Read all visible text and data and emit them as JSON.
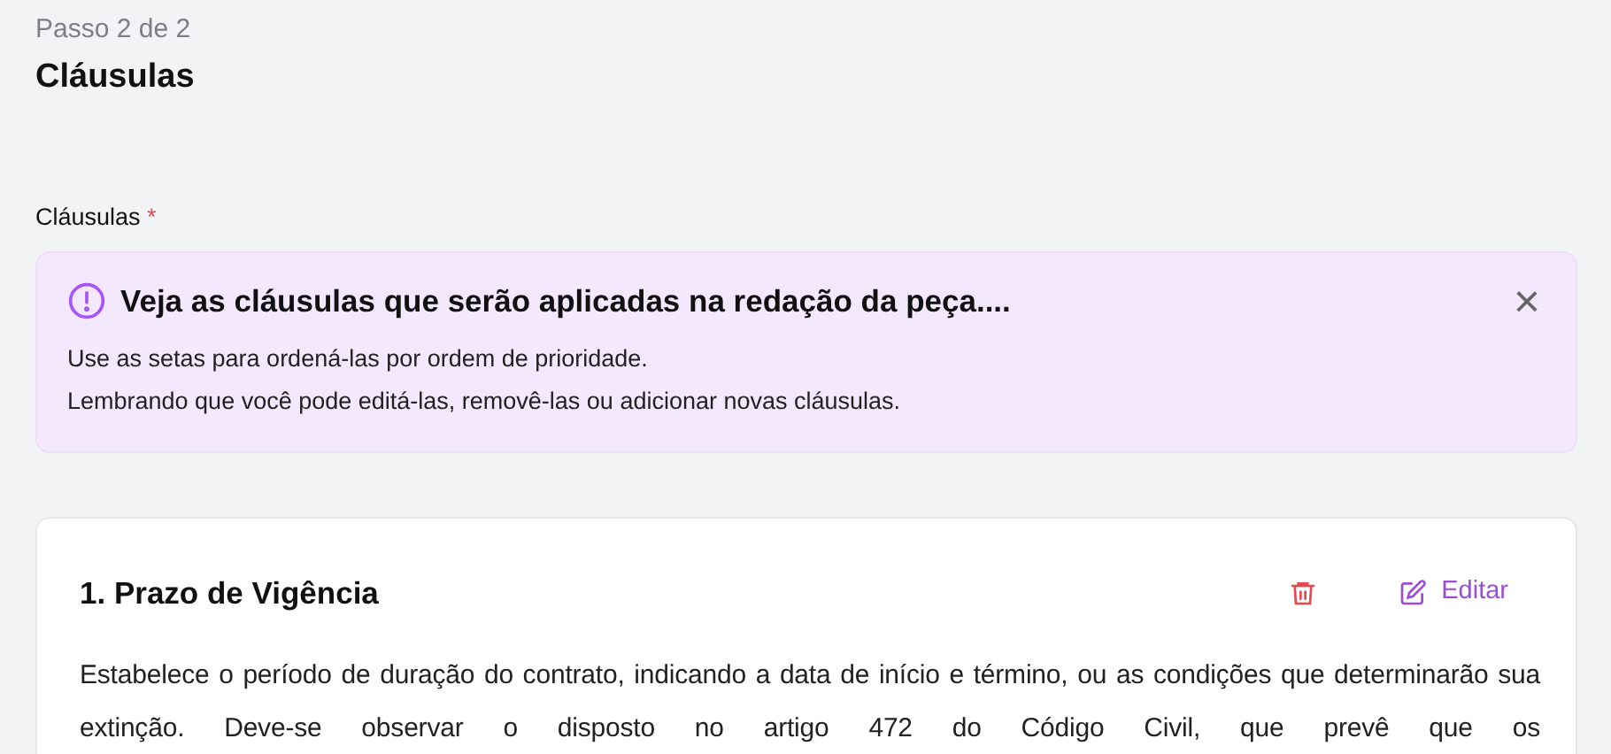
{
  "step": "Passo 2 de 2",
  "title": "Cláusulas",
  "field_label": {
    "text": "Cláusulas",
    "required": true,
    "required_mark": "*"
  },
  "alert": {
    "title": "Veja as cláusulas que serão aplicadas na redação da peça....",
    "lines": [
      "Use as setas para ordená-las por ordem de prioridade.",
      "Lembrando que você pode editá-las, removê-las ou adicionar novas cláusulas."
    ],
    "close": "×"
  },
  "clauses": [
    {
      "title": "1. Prazo de Vigência",
      "edit_label": "Editar",
      "text": "Estabelece o período de duração do contrato, indicando a data de início e término, ou as condições que determinarão sua extinção. Deve-se observar o disposto no artigo 472 do Código Civil, que prevê que os"
    }
  ]
}
